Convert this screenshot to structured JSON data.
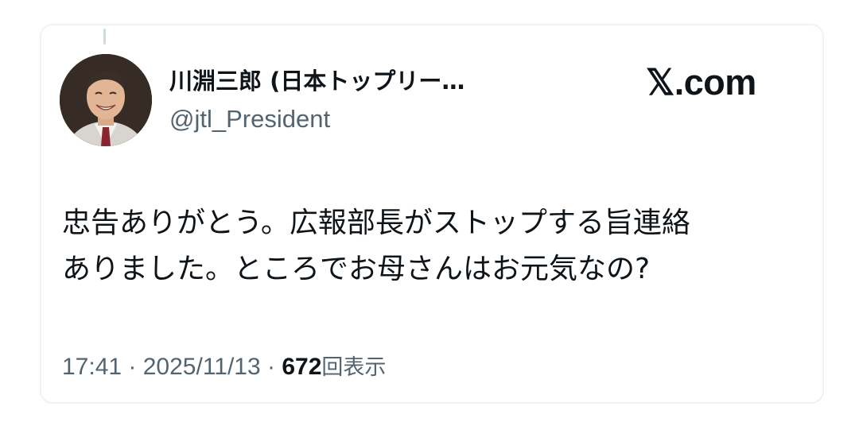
{
  "tweet": {
    "author": {
      "display_name": "川淵三郎 (日本トップリー…",
      "handle": "@jtl_President",
      "avatar": "profile-photo"
    },
    "brand": "𝕏.com",
    "text": "忠告ありがとう。広報部長がストップする旨連絡\nありました。ところでお母さんはお元気なの?",
    "time": "17:41",
    "separator": " · ",
    "date": "2025/11/13",
    "views_count": "672",
    "views_label": "回表示"
  },
  "colors": {
    "text_primary": "#0f1419",
    "text_secondary": "#536471",
    "border": "#eff3f4"
  }
}
